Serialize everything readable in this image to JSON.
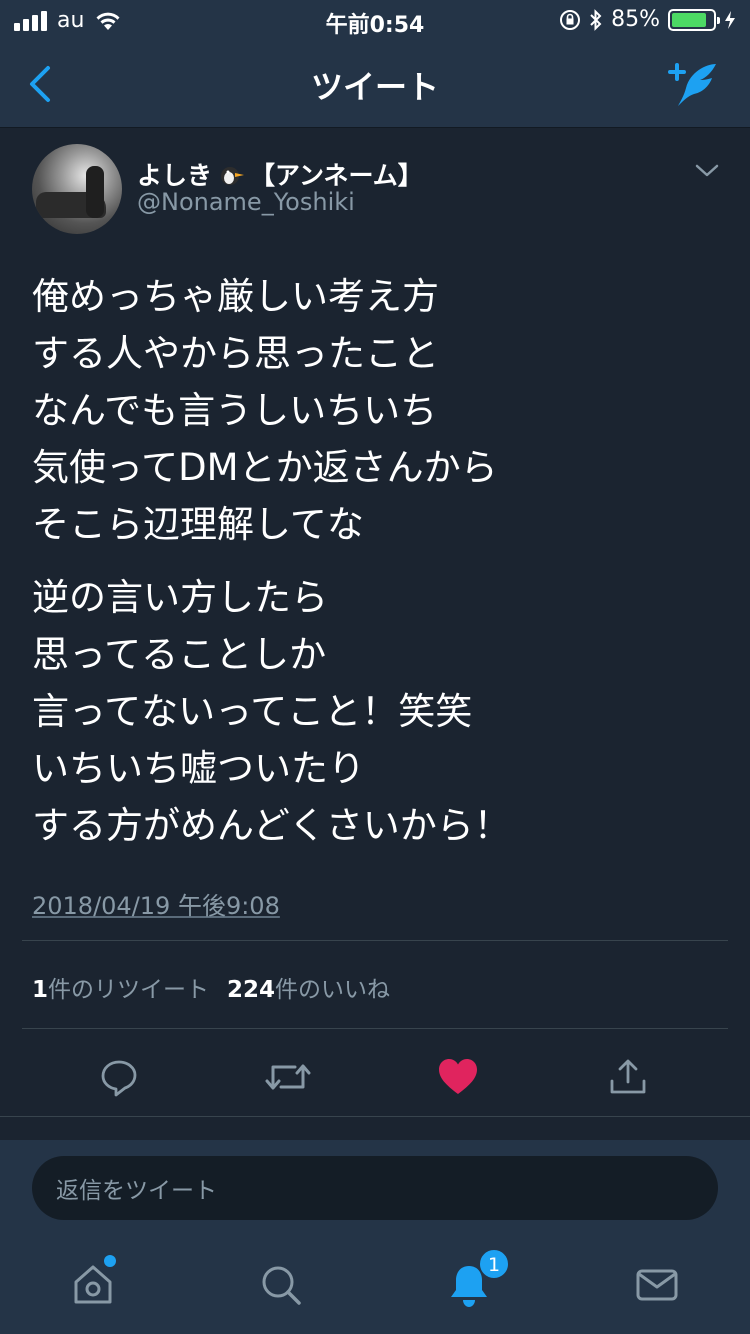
{
  "status_bar": {
    "carrier": "au",
    "time": "午前0:54",
    "battery": "85%",
    "battery_level": 0.85
  },
  "nav": {
    "title": "ツイート",
    "back_icon": "chevron-left-icon",
    "compose_icon": "compose-tweet-icon"
  },
  "tweet": {
    "display_name_prefix": "よしき",
    "display_name_suffix": "【アンネーム】",
    "handle": "@Noname_Yoshiki",
    "text_paragraphs": [
      "俺めっちゃ厳しい考え方\nする人やから思ったこと\nなんでも言うしいちいち\n気使ってDMとか返さんから\nそこら辺理解してな",
      "逆の言い方したら\n思ってることしか\n言ってないってこと！笑笑\nいちいち嘘ついたり\nする方がめんどくさいから！"
    ],
    "timestamp": "2018/04/19 午後9:08",
    "retweet_count": "1",
    "retweet_label": "件のリツイート",
    "like_count": "224",
    "like_label": "件のいいね"
  },
  "actions": {
    "reply_icon": "reply-icon",
    "retweet_icon": "retweet-icon",
    "like_icon": "heart-icon",
    "share_icon": "share-icon",
    "liked": true
  },
  "reply": {
    "placeholder": "返信をツイート"
  },
  "tab_bar": {
    "items": [
      "home-icon",
      "search-icon",
      "notifications-icon",
      "messages-icon"
    ],
    "notification_badge": "1"
  },
  "colors": {
    "background": "#1b2430",
    "bar": "#243447",
    "accent": "#1da1f2",
    "like": "#e0245e",
    "secondary_text": "#8899a6"
  }
}
